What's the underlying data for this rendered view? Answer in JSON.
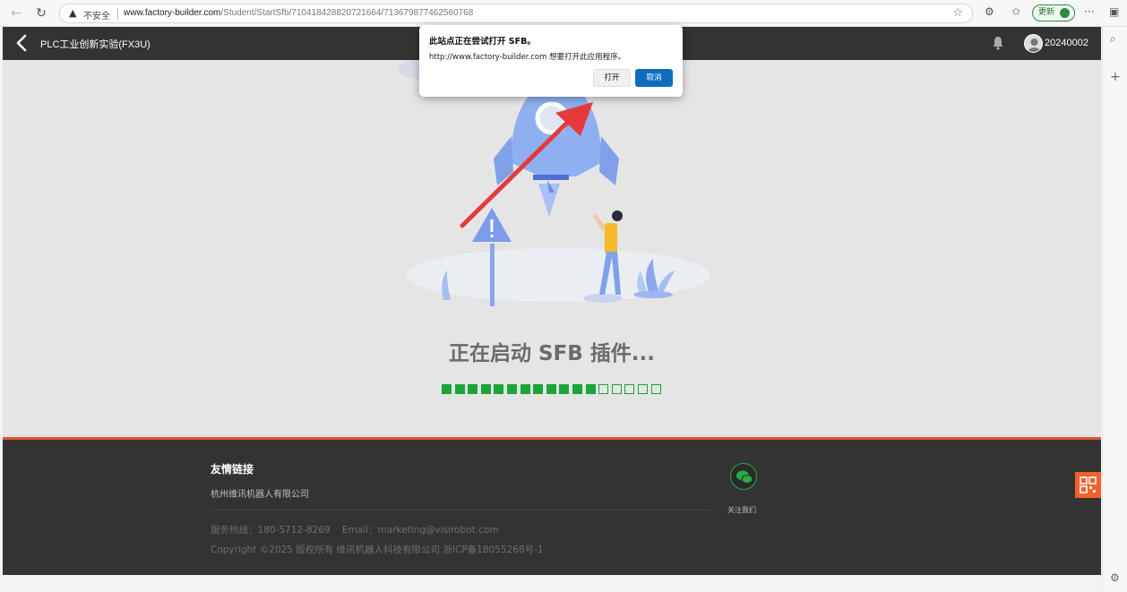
{
  "browser": {
    "security_label": "不安全",
    "url_host": "www.factory-builder.com",
    "url_path": "/Student/StartSfb/710418428820721664/713679877462560768",
    "update_label": "更新",
    "more_label": "···"
  },
  "header": {
    "title": "PLC工业创新实验(FX3U)",
    "user_id": "20240002"
  },
  "main": {
    "loading_text": "正在启动 SFB 插件...",
    "progress": {
      "filled": 12,
      "total": 17
    }
  },
  "footer": {
    "links_title": "友情链接",
    "link_company": "杭州维讯机器人有限公司",
    "hotline": "服务热线：180-5712-8269",
    "email": "Email：marketing@visirobot.com",
    "copyright": "Copyright ©2025 版权所有 维讯机器人科技有限公司 浙ICP备18055268号-1",
    "follow_label": "关注我们"
  },
  "dialog": {
    "title": "此站点正在尝试打开 SFB。",
    "message": "http://www.factory-builder.com 想要打开此应用程序。",
    "open_label": "打开",
    "cancel_label": "取消"
  },
  "colors": {
    "header_bg": "#333333",
    "footer_accent": "#e6532e",
    "progress_green": "#1aa53a",
    "dialog_primary": "#0f6cbd",
    "qr_button": "#f0612e"
  }
}
